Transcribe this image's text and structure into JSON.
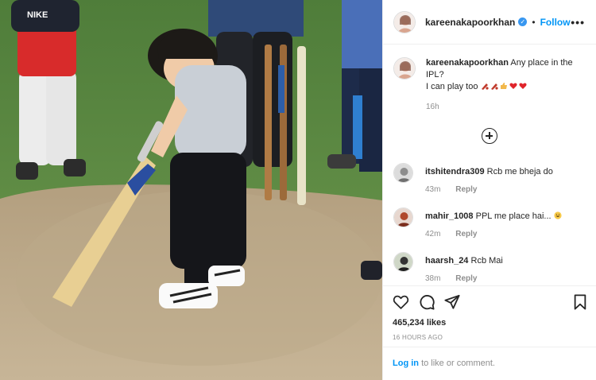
{
  "post": {
    "username": "kareenakapoorkhan",
    "follow_label": "Follow",
    "more_icon": "more-options-icon",
    "verified_icon": "verified-badge-icon"
  },
  "caption": {
    "username": "kareenakapoorkhan",
    "line1": "Any place in the IPL?",
    "line2": "I can play too",
    "time": "16h"
  },
  "comments": [
    {
      "username": "itshitendra309",
      "text": "Rcb me bheja do",
      "time": "43m",
      "reply": "Reply"
    },
    {
      "username": "mahir_1008",
      "text": "PPL me place hai...",
      "time": "42m",
      "reply": "Reply"
    },
    {
      "username": "haarsh_24",
      "text": "Rcb Mai",
      "time": "38m",
      "reply": "Reply"
    }
  ],
  "stats": {
    "likes": "465,234 likes",
    "posted": "16 HOURS AGO"
  },
  "footer": {
    "login_link": "Log in",
    "login_rest": "to like or comment."
  },
  "colors": {
    "accent": "#0095f6",
    "muted": "#8e8e8e",
    "heart": "#ed4956"
  }
}
